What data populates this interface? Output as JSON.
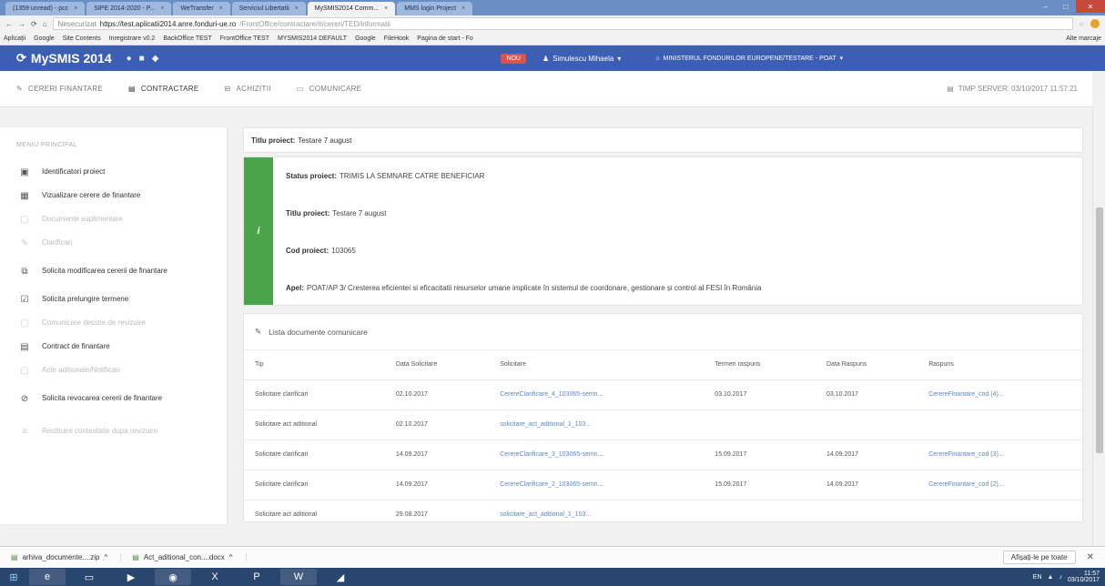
{
  "browser": {
    "tabs": [
      {
        "label": "(1359 unread) - pcc",
        "active": false
      },
      {
        "label": "SIPE 2014-2020 - P...",
        "active": false
      },
      {
        "label": "WeTransfer",
        "active": false
      },
      {
        "label": "Serviciul Libertatii",
        "active": false
      },
      {
        "label": "MySMIS2014 Comm...",
        "active": true
      },
      {
        "label": "MMS login Project",
        "active": false
      }
    ],
    "url": {
      "secure_label": "Nesecurizat",
      "host": "https://test.aplicatii2014.anre.fonduri-ue.ro",
      "path": "/FrontOffice/contractare/#/cereri/TED/informatii"
    },
    "bookmarks": [
      "Aplicații",
      "Google",
      "Site Contents",
      "Inregistrare v0.2",
      "BackOffice TEST",
      "FrontOffice TEST",
      "MYSMIS2014 DEFAULT",
      "Google",
      "FileHook",
      "Pagina de start - Fo"
    ],
    "other_bookmarks": "Alte marcaje"
  },
  "app": {
    "brand": "MySMIS 2014",
    "notification": "NOU",
    "user": "Simulescu Mihaela",
    "ministry": "MINISTERUL FONDURILOR EUROPENE/TESTARE - POAT",
    "menu": [
      {
        "label": "CERERI FINANTARE",
        "icon": "pencil-icon",
        "active": false
      },
      {
        "label": "CONTRACTARE",
        "icon": "contract-icon",
        "active": true
      },
      {
        "label": "ACHIZITII",
        "icon": "cart-icon",
        "active": false
      },
      {
        "label": "COMUNICARE",
        "icon": "chat-icon",
        "active": false
      }
    ],
    "server_time": "TIMP SERVER: 03/10/2017 11:57:21"
  },
  "sidebar": {
    "title": "MENIU PRINCIPAL",
    "items": [
      {
        "label": "Identificatori proiect",
        "icon": "id-card-icon",
        "disabled": false
      },
      {
        "label": "Vizualizare cerere de finantare",
        "icon": "grid-icon",
        "disabled": false
      },
      {
        "label": "Documente suplimentare",
        "icon": "document-icon",
        "disabled": true
      },
      {
        "label": "Clarificari",
        "icon": "pin-icon",
        "disabled": true
      },
      {
        "label": "Solicita modificarea cererii de finantare",
        "icon": "edit-icon",
        "disabled": false
      },
      {
        "label": "Solicita prelungire termene",
        "icon": "calendar-icon",
        "disabled": false
      },
      {
        "label": "Comunicare decizie de revizuire",
        "icon": "document-icon",
        "disabled": true
      },
      {
        "label": "Contract de finantare",
        "icon": "contract-icon",
        "disabled": false
      },
      {
        "label": "Acte aditionale/Notificari",
        "icon": "document-icon",
        "disabled": true
      },
      {
        "label": "Solicita revocarea cererii de finantare",
        "icon": "cancel-icon",
        "disabled": false
      },
      {
        "label": "Restituire contestatie dupa revizuire",
        "icon": "list-icon",
        "disabled": true
      }
    ]
  },
  "main": {
    "title_label": "Titlu proiect:",
    "title_value": "Testare 7 august",
    "info": {
      "status_label": "Status proiect:",
      "status_value": "TRIMIS LA SEMNARE CATRE BENEFICIAR",
      "title_label": "Titlu proiect:",
      "title_value": "Testare 7 august",
      "cod_label": "Cod proiect:",
      "cod_value": "103065",
      "apel_label": "Apel:",
      "apel_value": "POAT/AP 3/ Cresterea eficientei si eficacitatii resurselor umane implicate în sistemul de coordonare, gestionare și control al FESI în România"
    },
    "docs": {
      "title": "Lista documente comunicare",
      "columns": [
        "Tip",
        "Data Solicitare",
        "Solicitare",
        "Termen raspuns",
        "Data Raspuns",
        "Raspuns"
      ],
      "rows": [
        {
          "tip": "Solicitare clarificari",
          "data": "02.10.2017",
          "solicitare": "CerereClarificare_4_103065-semn...",
          "termen": "03.10.2017",
          "data_raspuns": "03.10.2017",
          "raspuns": "CerereFinantare_cod (4)..."
        },
        {
          "tip": "Solicitare act aditional",
          "data": "02.10.2017",
          "solicitare": "solicitare_act_aditional_1_103...",
          "termen": "",
          "data_raspuns": "",
          "raspuns": ""
        },
        {
          "tip": "Solicitare clarificari",
          "data": "14.09.2017",
          "solicitare": "CerereClarificare_3_103065-semn...",
          "termen": "15.09.2017",
          "data_raspuns": "14.09.2017",
          "raspuns": "CerereFinantare_cod (3)..."
        },
        {
          "tip": "Solicitare clarificari",
          "data": "14.09.2017",
          "solicitare": "CerereClarificare_2_103065-semn...",
          "termen": "15.09.2017",
          "data_raspuns": "14.09.2017",
          "raspuns": "CerereFinantare_cod (2)..."
        },
        {
          "tip": "Solicitare act aditional",
          "data": "29.08.2017",
          "solicitare": "solicitare_act_aditional_1_103...",
          "termen": "",
          "data_raspuns": "",
          "raspuns": ""
        }
      ]
    }
  },
  "downloads": {
    "items": [
      "arhiva_documente....zip",
      "Act_aditional_con....docx"
    ],
    "show_all": "Afișați-le pe toate"
  },
  "taskbar": {
    "lang": "EN",
    "time": "11:57",
    "date": "03/10/2017"
  }
}
